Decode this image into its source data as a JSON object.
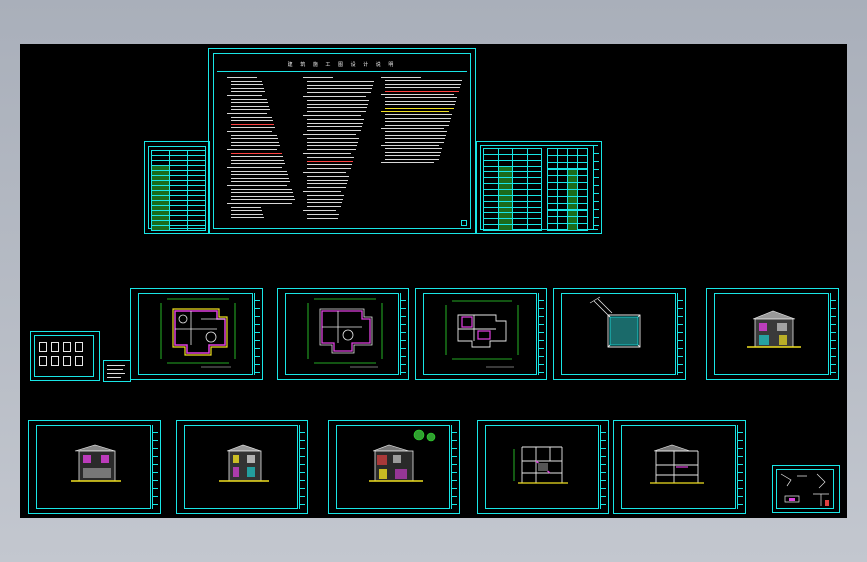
{
  "viewport": {
    "background": "#000000",
    "accent": "#19e6e6"
  },
  "design_notes_sheet": {
    "title": "建 筑 施 工 图 设 计 说 明"
  },
  "sheets": [
    "drawing-index",
    "design-notes",
    "materials-table",
    "door-window-schedule",
    "legend-small",
    "floor-plan-1",
    "floor-plan-2",
    "floor-plan-3",
    "roof-plan",
    "elevation-1",
    "elevation-2",
    "elevation-3",
    "elevation-4",
    "section-1",
    "section-2",
    "details"
  ],
  "colors": {
    "cad_cyan": "#19e6e6",
    "cad_white": "#e8e8e8",
    "cad_magenta": "#e040e0",
    "cad_yellow": "#f0e020",
    "cad_green": "#30e030",
    "cad_red": "#ff4040"
  }
}
